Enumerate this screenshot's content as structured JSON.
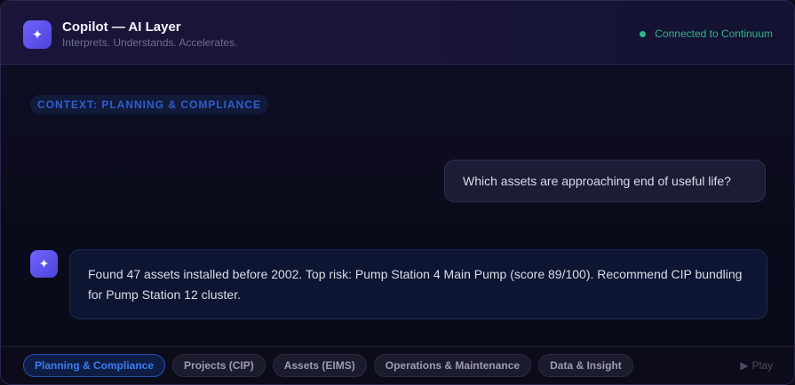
{
  "header": {
    "title": "Copilot — AI Layer",
    "subtitle": "Interprets. Understands. Accelerates.",
    "logo_icon": "sparkle-icon",
    "status": "Connected to Continuum",
    "status_color": "#2fb58a"
  },
  "context": {
    "label": "CONTEXT: PLANNING & COMPLIANCE"
  },
  "chat": {
    "user_message": "Which assets are approaching end of useful life?",
    "ai_icon": "sparkle-icon",
    "ai_message": "Found 47 assets installed before 2002. Top risk: Pump Station 4 Main Pump (score 89/100). Recommend CIP bundling for Pump Station 12 cluster."
  },
  "footer": {
    "tabs": [
      {
        "label": "Planning & Compliance",
        "active": true
      },
      {
        "label": "Projects (CIP)",
        "active": false
      },
      {
        "label": "Assets (EIMS)",
        "active": false
      },
      {
        "label": "Operations & Maintenance",
        "active": false
      },
      {
        "label": "Data & Insight",
        "active": false
      }
    ],
    "play_label": "Play",
    "play_icon": "play-icon"
  },
  "colors": {
    "accent": "#5a50ec",
    "active_tab": "#3d7cf0"
  }
}
